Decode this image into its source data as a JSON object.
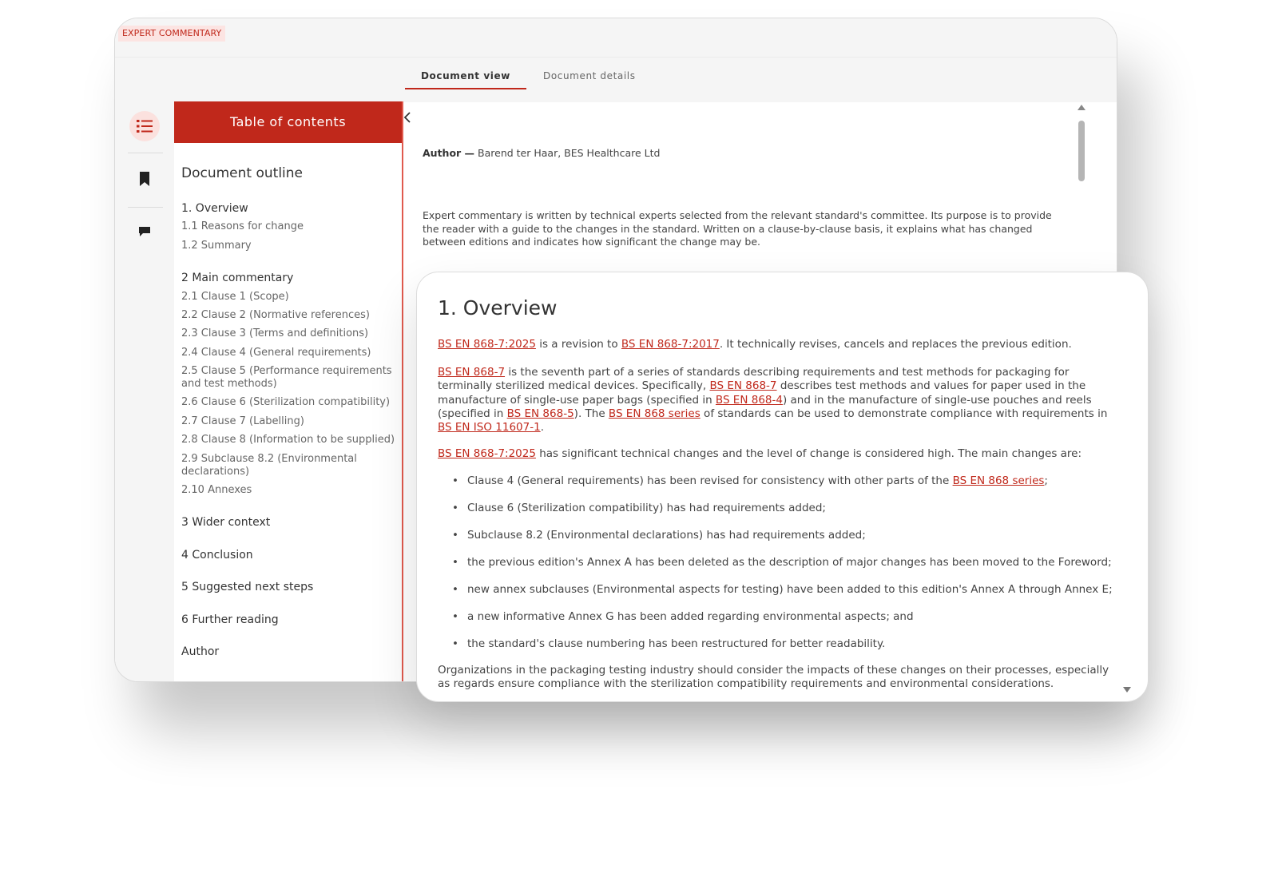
{
  "header": {
    "badge": "EXPERT COMMENTARY"
  },
  "tabs": [
    {
      "label": "Document view",
      "active": true
    },
    {
      "label": "Document details",
      "active": false
    }
  ],
  "rail": {
    "items": [
      "list-icon",
      "bookmark-icon",
      "comment-icon"
    ]
  },
  "toc": {
    "title": "Table of contents",
    "outline_heading": "Document outline",
    "items": [
      "1. Overview",
      "1.1 Reasons for change",
      "1.2 Summary",
      "2 Main commentary",
      "2.1 Clause 1 (Scope)",
      "2.2 Clause 2 (Normative references)",
      "2.3 Clause 3 (Terms and definitions)",
      "2.4 Clause 4 (General requirements)",
      "2.5 Clause 5 (Performance requirements and test methods)",
      "2.6 Clause 6 (Sterilization compatibility)",
      "2.7 Clause 7 (Labelling)",
      "2.8 Clause 8 (Information to be supplied)",
      "2.9 Subclause 8.2 (Environmental declarations)",
      "2.10 Annexes",
      "3 Wider context",
      "4 Conclusion",
      "5 Suggested next steps",
      "6 Further reading",
      "Author"
    ]
  },
  "document": {
    "author_label": "Author —",
    "author_value": " Barend ter Haar, BES Healthcare Ltd",
    "intro": "Expert commentary is written by technical experts selected from the relevant standard's committee. Its purpose is to provide the reader with a guide to the changes in the standard. Written on a clause-by-clause basis, it explains what has changed between editions and indicates how significant the change may be."
  },
  "overview": {
    "heading": "1. Overview",
    "p1": {
      "link1": "BS EN 868-7:2025",
      "t1": " is a revision to ",
      "link2": "BS EN 868-7:2017",
      "t2": ". It technically revises, cancels and replaces the previous edition."
    },
    "p2": {
      "link1": "BS EN 868-7",
      "t1": " is the seventh part of a series of standards describing requirements and test methods for packaging for terminally sterilized medical devices. Specifically, ",
      "link2": "BS EN 868-7",
      "t2": " describes test methods and values for paper used in the manufacture of single-use paper bags (specified in ",
      "link3": "BS EN 868-4",
      "t3": ") and in the manufacture of single-use pouches and reels (specified in ",
      "link4": "BS EN 868-5",
      "t4": "). The ",
      "link5": "BS EN 868 series",
      "t5": " of standards can be used to demonstrate compliance with requirements in ",
      "link6": "BS EN ISO 11607-1",
      "t6": "."
    },
    "p3": {
      "link1": "BS EN 868-7:2025",
      "t1": " has significant technical changes and the level of change is considered high. The main changes are:"
    },
    "bullets": {
      "b1_text": "Clause 4 (General requirements) has been revised for consistency with other parts of the ",
      "b1_link": "BS EN 868 series",
      "b1_end": ";",
      "b2": "Clause 6 (Sterilization compatibility) has had requirements added;",
      "b3": "Subclause 8.2 (Environmental declarations) has had requirements added;",
      "b4": "the previous edition's Annex A has been deleted as the description of major changes has been moved to the Foreword;",
      "b5": "new annex subclauses (Environmental aspects for testing) have been added to this edition's Annex A through Annex E;",
      "b6": "a new informative Annex G has been added regarding environmental aspects; and",
      "b7": "the standard's clause numbering has been restructured for better readability."
    },
    "closing": "Organizations in the packaging testing industry should consider the impacts of these changes on their processes, especially as regards ensure compliance with the sterilization compatibility requirements and environmental considerations."
  },
  "colors": {
    "accent": "#c0281b",
    "accent_light": "#fbe1de",
    "rail_bg": "#f5f5f5"
  }
}
